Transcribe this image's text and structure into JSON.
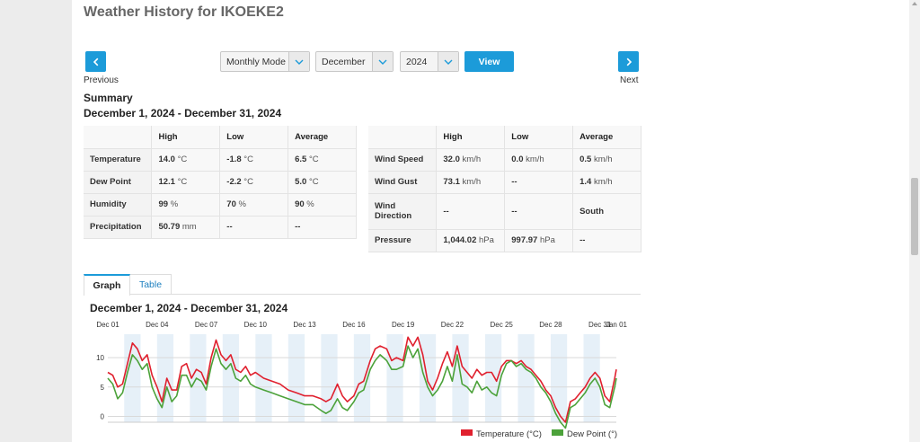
{
  "page": {
    "title": "Weather History for IKOEKE2"
  },
  "nav": {
    "previous_label": "Previous",
    "next_label": "Next",
    "previous_icon": "chevron-left-icon",
    "next_icon": "chevron-right-icon"
  },
  "controls": {
    "mode": "Monthly Mode",
    "month": "December",
    "year": "2024",
    "view_label": "View"
  },
  "summary": {
    "heading": "Summary",
    "date_range": "December 1, 2024 - December 31, 2024",
    "table_left": {
      "headers": [
        "",
        "High",
        "Low",
        "Average"
      ],
      "rows": [
        {
          "label": "Temperature",
          "high": "14.0",
          "high_unit": "°C",
          "low": "-1.8",
          "low_unit": "°C",
          "avg": "6.5",
          "avg_unit": "°C"
        },
        {
          "label": "Dew Point",
          "high": "12.1",
          "high_unit": "°C",
          "low": "-2.2",
          "low_unit": "°C",
          "avg": "5.0",
          "avg_unit": "°C"
        },
        {
          "label": "Humidity",
          "high": "99",
          "high_unit": "%",
          "low": "70",
          "low_unit": "%",
          "avg": "90",
          "avg_unit": "%"
        },
        {
          "label": "Precipitation",
          "high": "50.79",
          "high_unit": "mm",
          "low": "--",
          "low_unit": "",
          "avg": "--",
          "avg_unit": ""
        }
      ]
    },
    "table_right": {
      "headers": [
        "",
        "High",
        "Low",
        "Average"
      ],
      "rows": [
        {
          "label": "Wind Speed",
          "high": "32.0",
          "high_unit": "km/h",
          "low": "0.0",
          "low_unit": "km/h",
          "avg": "0.5",
          "avg_unit": "km/h"
        },
        {
          "label": "Wind Gust",
          "high": "73.1",
          "high_unit": "km/h",
          "low": "--",
          "low_unit": "",
          "avg": "1.4",
          "avg_unit": "km/h"
        },
        {
          "label": "Wind Direction",
          "high": "--",
          "high_unit": "",
          "low": "--",
          "low_unit": "",
          "avg": "South",
          "avg_unit": ""
        },
        {
          "label": "Pressure",
          "high": "1,044.02",
          "high_unit": "hPa",
          "low": "997.97",
          "low_unit": "hPa",
          "avg": "--",
          "avg_unit": ""
        }
      ]
    }
  },
  "tabs": [
    {
      "label": "Graph",
      "active": true
    },
    {
      "label": "Table",
      "active": false
    }
  ],
  "colors": {
    "accent": "#1c9bd9",
    "temperature": "#e0202e",
    "dew_point": "#4ca23a",
    "band": "#e6f0f8"
  },
  "chart_data": {
    "type": "line",
    "title": "December 1, 2024 - December 31, 2024",
    "x_tick_labels": [
      "Dec 01",
      "Dec 04",
      "Dec 07",
      "Dec 10",
      "Dec 13",
      "Dec 16",
      "Dec 19",
      "Dec 22",
      "Dec 25",
      "Dec 28",
      "Dec 31",
      "Jan 01"
    ],
    "x_range_days": [
      0,
      31
    ],
    "y_tick_labels": [
      "0",
      "5",
      "10"
    ],
    "ylim": [
      -1,
      14
    ],
    "grid": true,
    "legend_position": "bottom-right",
    "x_days": [
      0,
      0.3,
      0.6,
      0.9,
      1.2,
      1.5,
      1.8,
      2.1,
      2.4,
      2.7,
      3.0,
      3.3,
      3.6,
      3.9,
      4.2,
      4.5,
      4.8,
      5.1,
      5.4,
      5.7,
      6.0,
      6.3,
      6.6,
      6.9,
      7.2,
      7.5,
      7.8,
      8.1,
      8.4,
      8.7,
      9.0,
      9.5,
      10.0,
      10.5,
      11.0,
      11.5,
      12.0,
      12.5,
      13.0,
      13.3,
      13.6,
      14.0,
      14.3,
      14.6,
      15.0,
      15.3,
      15.6,
      16.0,
      16.3,
      16.6,
      17.0,
      17.3,
      17.6,
      18.0,
      18.3,
      18.6,
      18.9,
      19.2,
      19.5,
      19.8,
      20.1,
      20.4,
      20.7,
      21.0,
      21.3,
      21.6,
      21.9,
      22.2,
      22.5,
      22.8,
      23.1,
      23.4,
      23.7,
      24.0,
      24.3,
      24.6,
      24.9,
      25.2,
      25.5,
      25.8,
      26.1,
      26.4,
      26.7,
      27.0,
      27.3,
      27.6,
      27.9,
      28.2,
      28.5,
      28.8,
      29.1,
      29.4,
      29.7,
      30.0,
      30.3,
      30.6,
      30.9,
      31.0
    ],
    "series": [
      {
        "name": "Temperature (°C)",
        "color": "#e0202e",
        "values": [
          7.5,
          7.0,
          5.0,
          5.5,
          9.0,
          12.5,
          11.5,
          9.5,
          10.5,
          7.0,
          5.0,
          2.5,
          6.5,
          4.5,
          4.5,
          8.5,
          9.0,
          6.5,
          8.0,
          7.5,
          5.5,
          10.0,
          13.0,
          10.5,
          9.5,
          10.5,
          8.0,
          7.5,
          8.5,
          7.0,
          7.5,
          6.5,
          6.0,
          5.5,
          4.5,
          4.0,
          3.5,
          3.5,
          3.0,
          2.5,
          3.0,
          5.5,
          3.5,
          2.5,
          3.5,
          5.5,
          6.0,
          9.5,
          11.5,
          12.0,
          11.5,
          9.5,
          10.0,
          9.5,
          13.5,
          12.0,
          13.5,
          10.5,
          6.0,
          4.5,
          6.5,
          9.0,
          11.0,
          8.5,
          12.0,
          8.5,
          7.5,
          6.5,
          8.0,
          7.0,
          7.5,
          7.5,
          6.0,
          8.5,
          9.5,
          9.5,
          9.0,
          9.5,
          8.5,
          8.0,
          7.0,
          6.0,
          4.5,
          3.5,
          1.5,
          0.0,
          -1.0,
          2.5,
          3.0,
          4.0,
          5.0,
          6.5,
          7.5,
          6.5,
          3.5,
          2.5,
          6.5,
          8.0
        ]
      },
      {
        "name": "Dew Point (°)",
        "color": "#4ca23a",
        "values": [
          6.5,
          5.5,
          3.0,
          4.0,
          7.5,
          10.5,
          9.5,
          8.0,
          9.0,
          5.0,
          3.0,
          1.5,
          5.0,
          2.5,
          3.5,
          7.0,
          7.0,
          5.0,
          6.5,
          6.0,
          4.5,
          8.5,
          11.5,
          9.0,
          8.0,
          9.0,
          6.5,
          6.0,
          7.0,
          5.5,
          5.0,
          4.5,
          4.0,
          3.5,
          3.0,
          2.5,
          2.0,
          2.0,
          1.0,
          0.5,
          1.0,
          3.0,
          1.5,
          1.0,
          2.5,
          4.0,
          4.5,
          8.0,
          9.5,
          10.5,
          9.5,
          8.0,
          8.0,
          8.5,
          12.0,
          10.0,
          11.5,
          7.5,
          5.0,
          3.5,
          4.5,
          6.0,
          8.5,
          6.0,
          10.5,
          5.5,
          5.0,
          4.0,
          6.0,
          4.5,
          5.0,
          4.0,
          3.5,
          7.0,
          9.0,
          9.5,
          8.5,
          9.0,
          8.0,
          7.5,
          6.5,
          5.0,
          4.0,
          2.5,
          0.5,
          -1.0,
          -2.0,
          1.5,
          2.0,
          3.0,
          4.0,
          5.5,
          6.5,
          5.0,
          2.0,
          1.5,
          5.0,
          6.5
        ]
      }
    ]
  }
}
